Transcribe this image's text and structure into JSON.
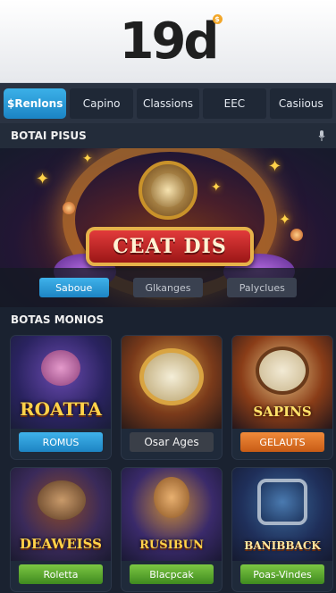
{
  "header": {
    "logo": "19d",
    "logo_badge": "$"
  },
  "tabs": [
    {
      "label": "$Renlons",
      "active": true
    },
    {
      "label": "Capino",
      "active": false
    },
    {
      "label": "Classions",
      "active": false
    },
    {
      "label": "EEC",
      "active": false
    },
    {
      "label": "Casiious",
      "active": false
    }
  ],
  "featured": {
    "section_title": "BOTAI PISUS",
    "banner_title": "CEAT DIS",
    "buttons": [
      "Saboue",
      "Glkanges",
      "Palyclues"
    ]
  },
  "games_section": {
    "title": "BOTAS MONIOS",
    "games": [
      {
        "title": "ROATTA",
        "button": "ROMUS",
        "button_style": "blue"
      },
      {
        "title": "",
        "button": "Osar Ages",
        "button_style": "dark"
      },
      {
        "title": "SAPINS",
        "button": "GELAUTS",
        "button_style": "orange"
      },
      {
        "title": "DEAWEISS",
        "button": "Roletta",
        "button_style": "green"
      },
      {
        "title": "RUSIBUN",
        "button": "Blacpcak",
        "button_style": "green"
      },
      {
        "title": "BANIBBACK",
        "button": "Poas-Vindes",
        "button_style": "green"
      }
    ]
  },
  "colors": {
    "accent_blue": "#2a9ad6",
    "header_bg": "#ffffff",
    "app_bg": "#1a2230",
    "button_green": "#5aaa30",
    "button_orange": "#e07428"
  }
}
